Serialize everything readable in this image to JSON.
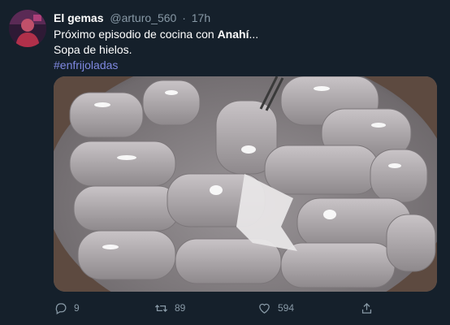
{
  "tweet": {
    "display_name": "El gemas",
    "handle": "@arturo_560",
    "separator": "·",
    "time": "17h",
    "text_prefix": "Próximo episodio de cocina con ",
    "text_bold": "Anahí",
    "text_suffix": "...",
    "line2": "Sopa de hielos.",
    "hashtag": "#enfrijoladas"
  },
  "actions": {
    "replies": "9",
    "retweets": "89",
    "likes": "594"
  },
  "icons": [
    "reply-icon",
    "retweet-icon",
    "like-icon",
    "share-icon"
  ],
  "colors": {
    "background": "#15202b",
    "secondary_text": "#8899a6",
    "hashtag": "#7f88e0"
  }
}
